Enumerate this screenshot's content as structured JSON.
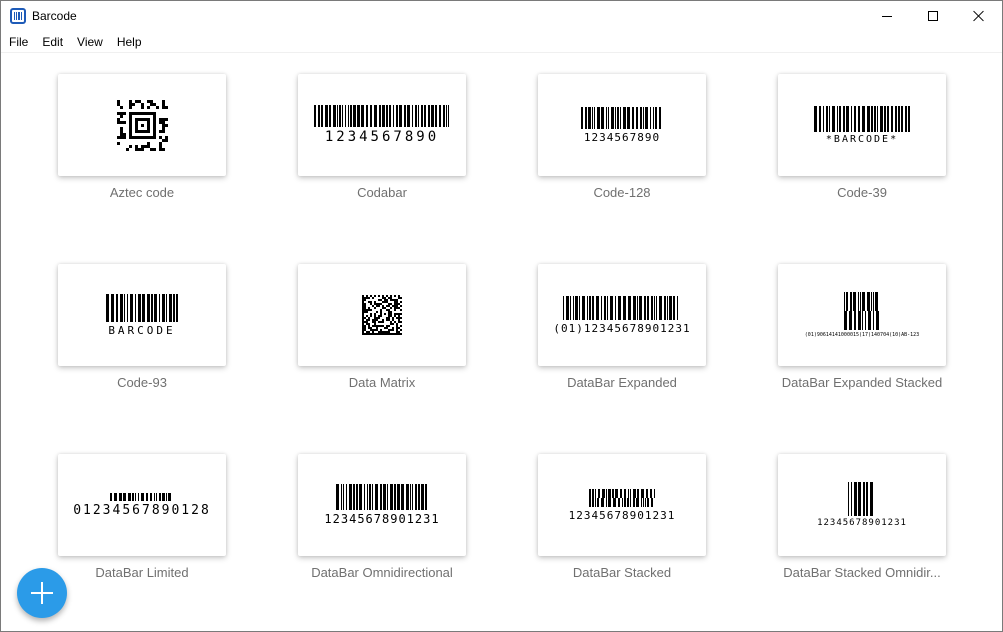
{
  "window": {
    "title": "Barcode"
  },
  "menu": [
    "File",
    "Edit",
    "View",
    "Help"
  ],
  "tiles": [
    {
      "label": "Aztec code",
      "kind": "aztec",
      "text": ""
    },
    {
      "label": "Codabar",
      "kind": "linear",
      "text": "1234567890"
    },
    {
      "label": "Code-128",
      "kind": "linear",
      "text": "1234567890"
    },
    {
      "label": "Code-39",
      "kind": "linear",
      "text": "*BARCODE*"
    },
    {
      "label": "Code-93",
      "kind": "linear",
      "text": "BARCODE"
    },
    {
      "label": "Data Matrix",
      "kind": "datamatrix",
      "text": ""
    },
    {
      "label": "DataBar Expanded",
      "kind": "linear",
      "text": "(01)12345678901231"
    },
    {
      "label": "DataBar Expanded Stacked",
      "kind": "stacked",
      "text": "(01)90614141000015(17)140704(10)AB-123"
    },
    {
      "label": "DataBar Limited",
      "kind": "linear",
      "text": "01234567890128"
    },
    {
      "label": "DataBar Omnidirectional",
      "kind": "linear",
      "text": "12345678901231"
    },
    {
      "label": "DataBar Stacked",
      "kind": "stacked",
      "text": "12345678901231"
    },
    {
      "label": "DataBar Stacked Omnidir...",
      "kind": "linear",
      "text": "12345678901231"
    }
  ],
  "fab": {
    "icon": "plus-icon",
    "color": "#2b9be8"
  },
  "accent": "#1e5bb8"
}
